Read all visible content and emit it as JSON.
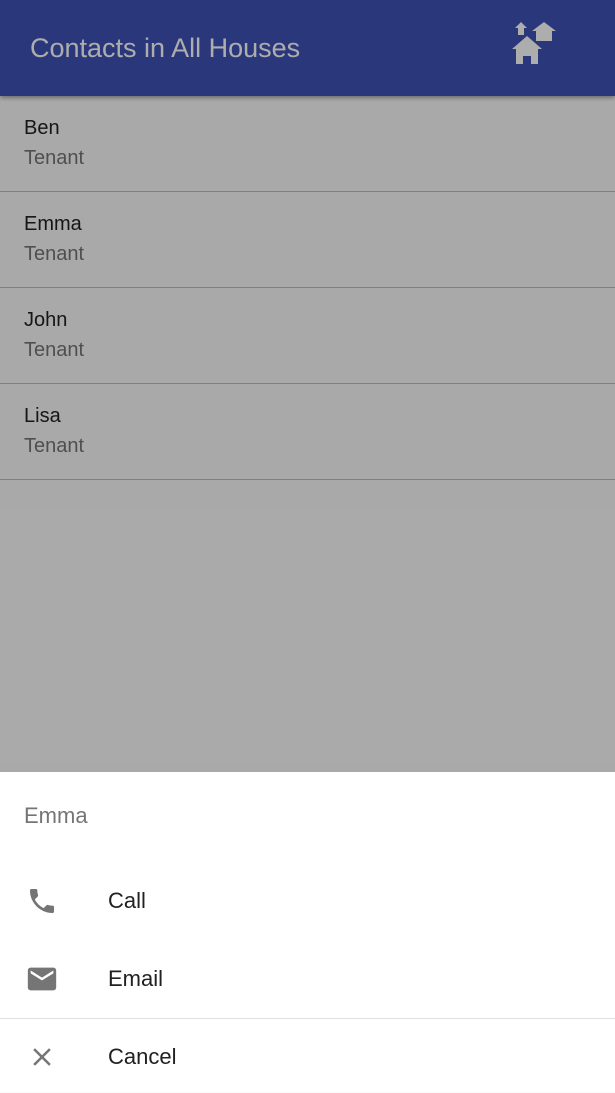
{
  "appbar": {
    "title": "Contacts in All Houses",
    "action_icon": "houses-icon"
  },
  "contacts": [
    {
      "name": "Ben",
      "role": "Tenant"
    },
    {
      "name": "Emma",
      "role": "Tenant"
    },
    {
      "name": "John",
      "role": "Tenant"
    },
    {
      "name": "Lisa",
      "role": "Tenant"
    }
  ],
  "sheet": {
    "title": "Emma",
    "actions": [
      {
        "label": "Call",
        "icon": "phone-icon"
      },
      {
        "label": "Email",
        "icon": "email-icon"
      },
      {
        "label": "Cancel",
        "icon": "close-icon"
      }
    ]
  },
  "colors": {
    "primary": "#3f51b5",
    "scrim": "rgba(0,0,0,0.32)",
    "icon": "#757575"
  }
}
